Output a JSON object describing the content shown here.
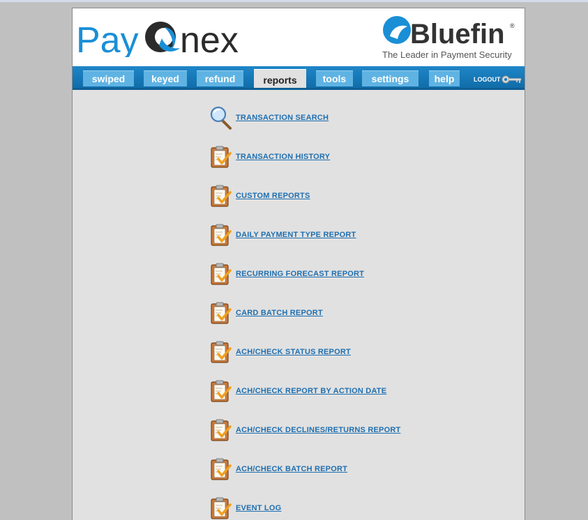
{
  "brand": {
    "paycon_left": "Pay",
    "paycon_right": "nex",
    "bluefin_name": "Bluefin",
    "bluefin_mark": "®",
    "bluefin_tagline": "The Leader in Payment Security"
  },
  "nav": {
    "tabs": [
      {
        "label": "swiped"
      },
      {
        "label": "keyed"
      },
      {
        "label": "refund"
      },
      {
        "label": "reports",
        "active": true
      },
      {
        "label": "tools"
      },
      {
        "label": "settings"
      },
      {
        "label": "help"
      }
    ],
    "logout_label": "LOGOUT"
  },
  "reports": [
    {
      "label": "TRANSACTION SEARCH",
      "icon": "magnifier-icon"
    },
    {
      "label": "TRANSACTION HISTORY",
      "icon": "clipboard-check-icon"
    },
    {
      "label": "CUSTOM REPORTS",
      "icon": "clipboard-check-icon"
    },
    {
      "label": "DAILY PAYMENT TYPE REPORT",
      "icon": "clipboard-check-icon"
    },
    {
      "label": "RECURRING FORECAST REPORT",
      "icon": "clipboard-check-icon"
    },
    {
      "label": "CARD BATCH REPORT",
      "icon": "clipboard-check-icon"
    },
    {
      "label": "ACH/CHECK STATUS REPORT",
      "icon": "clipboard-check-icon"
    },
    {
      "label": "ACH/CHECK REPORT BY ACTION DATE",
      "icon": "clipboard-check-icon"
    },
    {
      "label": "ACH/CHECK DECLINES/RETURNS REPORT",
      "icon": "clipboard-check-icon"
    },
    {
      "label": "ACH/CHECK BATCH REPORT",
      "icon": "clipboard-check-icon"
    },
    {
      "label": "EVENT LOG",
      "icon": "clipboard-check-icon"
    }
  ],
  "colors": {
    "nav_blue": "#1f86c8",
    "tab_blue": "#5fb3e3",
    "link_blue": "#1f6fb0",
    "paycon_blue": "#1a8fd6",
    "paycon_dark": "#2b2b2b"
  }
}
